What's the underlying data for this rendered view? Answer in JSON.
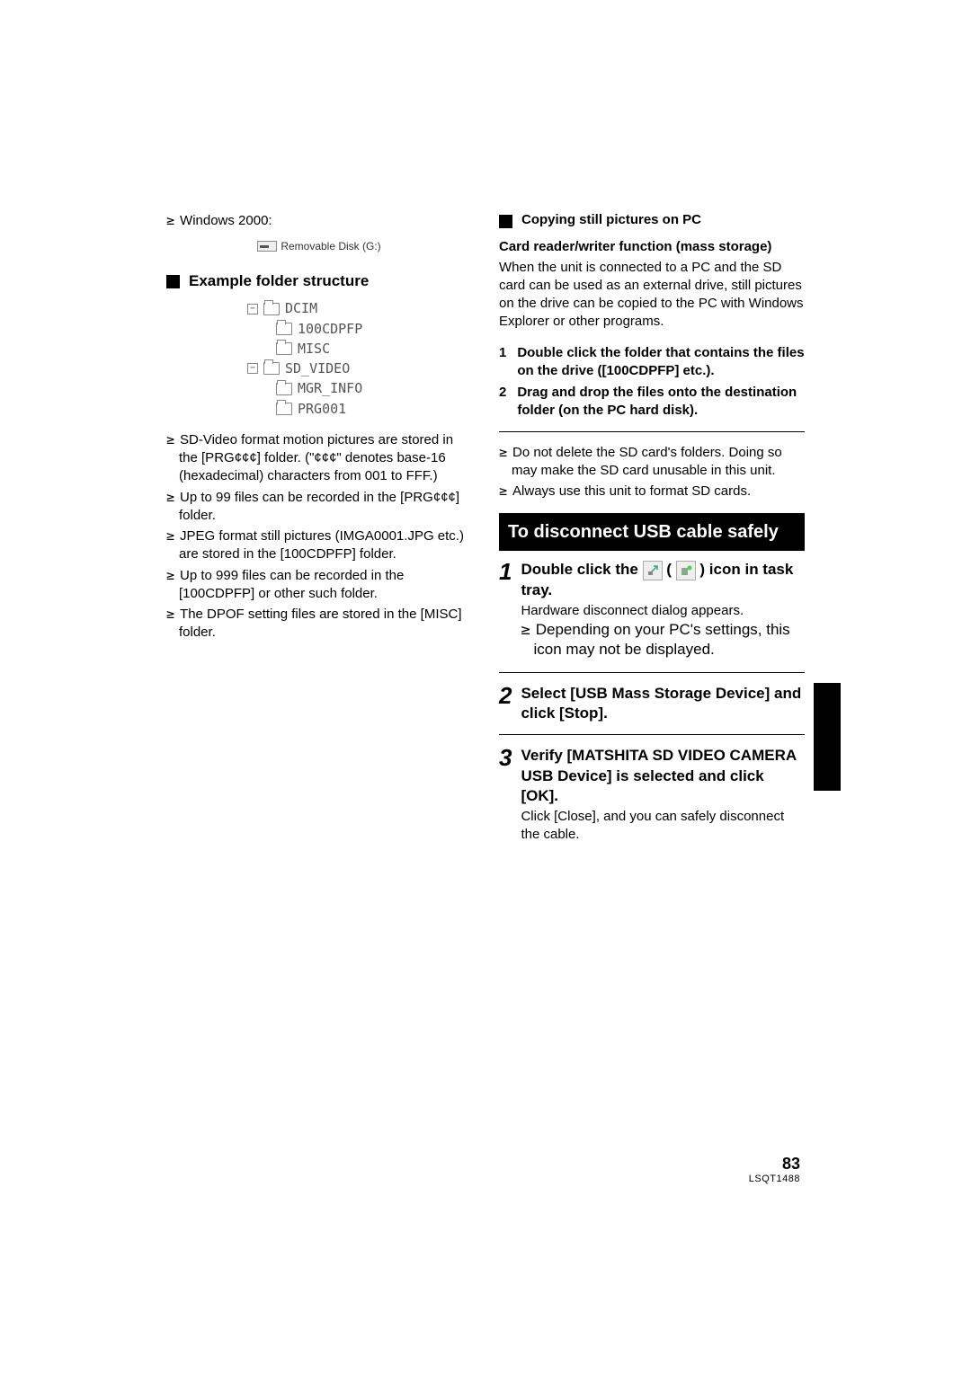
{
  "left": {
    "win2000": "Windows 2000:",
    "drive_label": "Removable Disk (G:)",
    "example_heading": "Example folder structure",
    "tree": {
      "dcim": "DCIM",
      "cdpfp": "100CDPFP",
      "misc": "MISC",
      "sdvideo": "SD_VIDEO",
      "mgrinfo": "MGR_INFO",
      "prg": "PRG001"
    },
    "notes": [
      "SD-Video format motion pictures are stored in the [PRG¢¢¢] folder. (\"¢¢¢\" denotes base-16 (hexadecimal) characters from 001 to FFF.)",
      "Up to 99 files can be recorded in the [PRG¢¢¢] folder.",
      "JPEG format still pictures (IMGA0001.JPG etc.) are stored in the [100CDPFP] folder.",
      "Up to 999 files can be recorded in the [100CDPFP] or other such folder.",
      "The DPOF setting files are stored in the [MISC] folder."
    ]
  },
  "right": {
    "copy_heading": "Copying still pictures on PC",
    "card_reader": "Card reader/writer function (mass storage)",
    "card_reader_body": "When the unit is connected to a PC and the SD card can be used as an external drive, still pictures on the drive can be copied to the PC with Windows Explorer or other programs.",
    "steps_copy": [
      {
        "n": "1",
        "t": "Double click the folder that contains the files on the drive ([100CDPFP] etc.)."
      },
      {
        "n": "2",
        "t": "Drag and drop the files onto the destination folder (on the PC hard disk)."
      }
    ],
    "copy_notes": [
      "Do not delete the SD card's folders. Doing so may make the SD card unusable in this unit.",
      "Always use this unit to format SD cards."
    ],
    "disconnect_title": "To disconnect USB cable safely",
    "step1_a": "Double click the ",
    "step1_b": " ( ",
    "step1_c": " ) icon in task tray.",
    "step1_sub": "Hardware disconnect dialog appears.",
    "step1_note": "Depending on your PC's settings, this icon may not be displayed.",
    "step2": "Select [USB Mass Storage Device] and click [Stop].",
    "step3": "Verify [MATSHITA SD VIDEO CAMERA USB Device] is selected and click [OK].",
    "step3_sub": "Click [Close], and you can safely disconnect the cable."
  },
  "page": {
    "number": "83",
    "code": "LSQT1488"
  }
}
